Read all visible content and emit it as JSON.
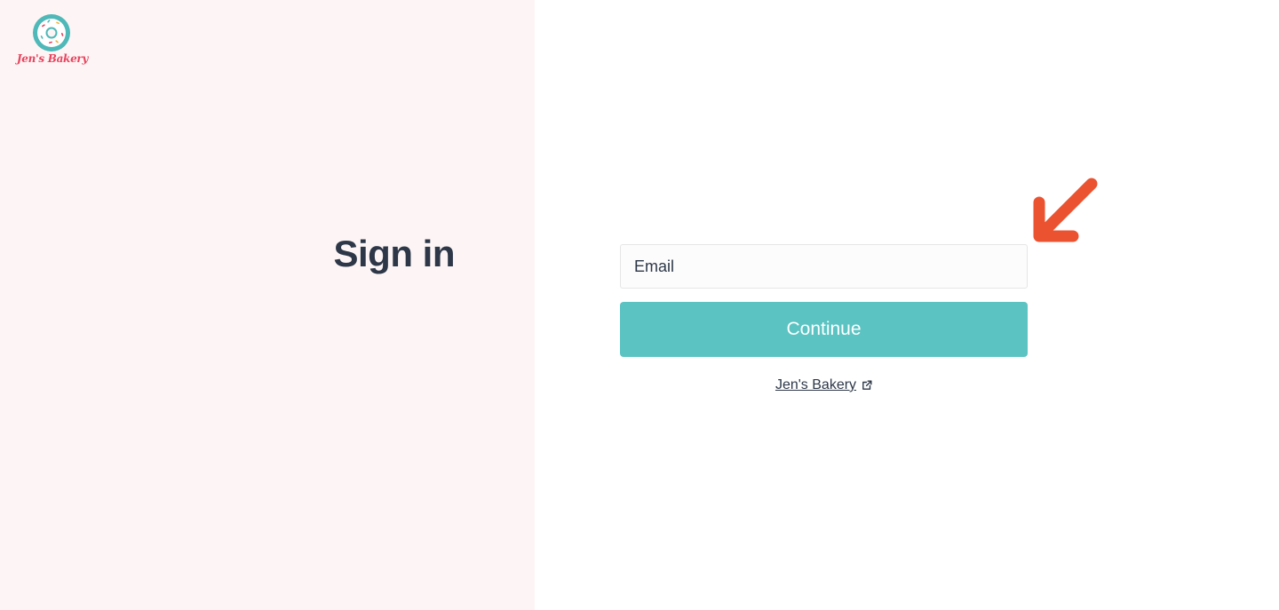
{
  "brand": {
    "name": "Jen's Bakery",
    "logo_icon": "donut-icon",
    "colors": {
      "brand_red": "#e8445e",
      "brand_teal": "#4fb8b8",
      "left_panel_bg": "#fdf5f5",
      "primary_button": "#5bc3c2",
      "text_dark": "#2d3748",
      "annotation_arrow": "#ea5230"
    }
  },
  "page": {
    "title": "Sign in"
  },
  "form": {
    "email_placeholder": "Email",
    "email_value": "",
    "continue_label": "Continue"
  },
  "footer_link": {
    "label": "Jen's Bakery",
    "icon": "external-link-icon"
  },
  "annotation": {
    "icon": "arrow-down-left-icon"
  }
}
